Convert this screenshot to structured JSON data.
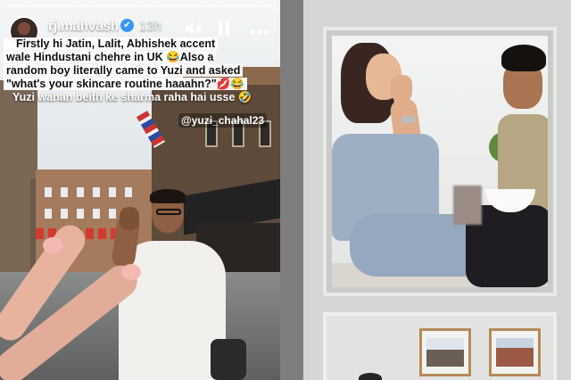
{
  "story": {
    "username": "rj.mahvash",
    "verified_badge": "✔",
    "time_ago": "13h",
    "controls": {
      "mute_icon": "speaker-muted-icon",
      "pause_icon": "pause-icon",
      "more_icon": "more-dots-icon"
    },
    "caption_lines": [
      "Firstly hi Jatin, Lalit, Abhishek accent",
      "wale Hindustani chehre in UK 😂Also a",
      "random boy literally came to Yuzi and asked",
      "\"what's your skincare routine haaahn?\"💋😂",
      "Yuzi wahan beith ke sharma raha hai usse 🤣"
    ],
    "mention": "@yuzi_chahal23"
  },
  "right_panel": {
    "top_frame_photo": "couple-photo",
    "bottom_frame_photos": [
      "building-photo",
      "painting-photo"
    ]
  }
}
